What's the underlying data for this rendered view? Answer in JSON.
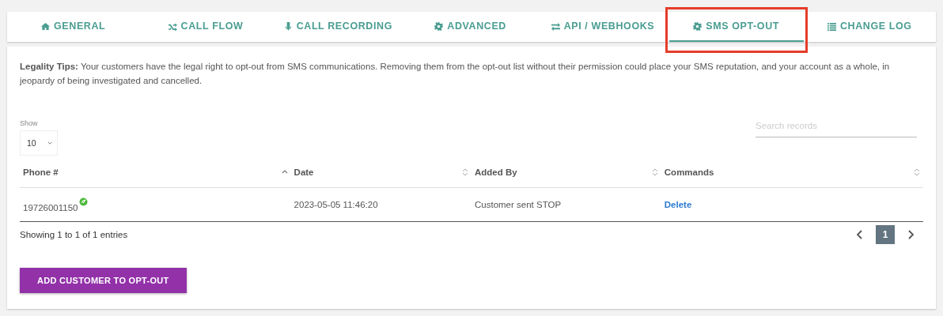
{
  "tabs": [
    {
      "label": "GENERAL",
      "selected": false,
      "highlighted": false
    },
    {
      "label": "CALL FLOW",
      "selected": false,
      "highlighted": false
    },
    {
      "label": "CALL RECORDING",
      "selected": false,
      "highlighted": false
    },
    {
      "label": "ADVANCED",
      "selected": false,
      "highlighted": false
    },
    {
      "label": "API / WEBHOOKS",
      "selected": false,
      "highlighted": false
    },
    {
      "label": "SMS OPT-OUT",
      "selected": true,
      "highlighted": true
    },
    {
      "label": "CHANGE LOG",
      "selected": false,
      "highlighted": false
    }
  ],
  "tip": "**Legality Tips:** Your customers have the legal right to opt-out from SMS communications. Removing them from the opt-out list without their permission could place your SMS reputation, and your account as a whole, in jeopardy of being investigated and cancelled.",
  "show": {
    "label": "Show",
    "value": "10"
  },
  "search": {
    "placeholder": "Search records"
  },
  "table": {
    "columns": [
      {
        "label": "Phone #",
        "sorted_ascending": true
      },
      {
        "label": "Date",
        "sorted_ascending": false
      },
      {
        "label": "Added By",
        "sorted_ascending": false
      },
      {
        "label": "Commands",
        "sorted_ascending": false
      }
    ],
    "rows": [
      {
        "phone": "19726001150",
        "date": "2023-05-05 11:46:20",
        "added_by": "Customer sent STOP",
        "command": "Delete"
      }
    ]
  },
  "info": "Showing 1 to 1 of 1 entries",
  "pagination": {
    "pages": [
      {
        "label": "1",
        "selected": true
      }
    ]
  },
  "add_button": "ADD CUSTOMER TO OPT-OUT"
}
